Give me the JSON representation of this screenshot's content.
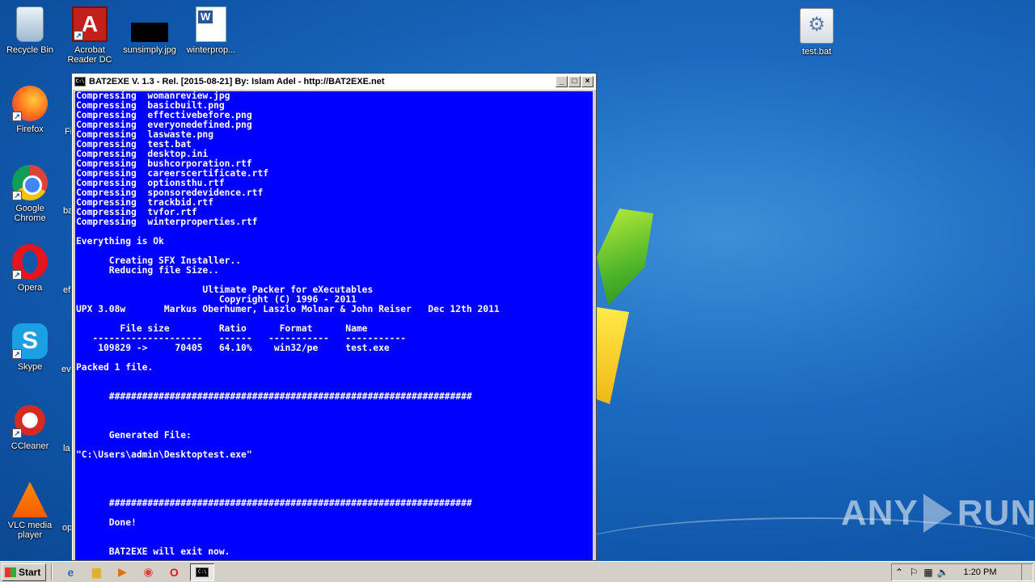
{
  "desktop": {
    "icons": [
      {
        "label": "Recycle Bin",
        "icon": "recycle-bin-icon"
      },
      {
        "label": "Acrobat Reader DC",
        "icon": "acrobat-reader-icon"
      },
      {
        "label": "sunsimply.jpg",
        "icon": "image-file-icon"
      },
      {
        "label": "winterprop...",
        "icon": "word-document-icon"
      },
      {
        "label": "test.bat",
        "icon": "batch-file-icon"
      },
      {
        "label": "Firefox",
        "icon": "firefox-icon"
      },
      {
        "label": "Google Chrome",
        "icon": "chrome-icon"
      },
      {
        "label": "Opera",
        "icon": "opera-icon"
      },
      {
        "label": "Skype",
        "icon": "skype-icon"
      },
      {
        "label": "CCleaner",
        "icon": "ccleaner-icon"
      },
      {
        "label": "VLC media player",
        "icon": "vlc-icon"
      }
    ],
    "partial_labels": [
      "Fi",
      "ba",
      "ef",
      "ev",
      "la",
      "op"
    ]
  },
  "window": {
    "title": "BAT2EXE V. 1.3 - Rel. [2015-08-21] By: Islam Adel - http://BAT2EXE.net",
    "console_lines": [
      "Compressing  womanreview.jpg",
      "Compressing  basicbuilt.png",
      "Compressing  effectivebefore.png",
      "Compressing  everyonedefined.png",
      "Compressing  laswaste.png",
      "Compressing  test.bat",
      "Compressing  desktop.ini",
      "Compressing  bushcorporation.rtf",
      "Compressing  careerscertificate.rtf",
      "Compressing  optionsthu.rtf",
      "Compressing  sponsoredevidence.rtf",
      "Compressing  trackbid.rtf",
      "Compressing  tvfor.rtf",
      "Compressing  winterproperties.rtf",
      "",
      "Everything is Ok",
      "",
      "      Creating SFX Installer..",
      "      Reducing file Size..",
      "",
      "                       Ultimate Packer for eXecutables",
      "                          Copyright (C) 1996 - 2011",
      "UPX 3.08w       Markus Oberhumer, Laszlo Molnar & John Reiser   Dec 12th 2011",
      "",
      "        File size         Ratio      Format      Name",
      "   --------------------   ------   -----------   -----------",
      "    109829 ->     70405   64.10%    win32/pe     test.exe",
      "",
      "Packed 1 file.",
      "",
      "",
      "      ##################################################################",
      "",
      "",
      "",
      "      Generated File:",
      "",
      "\"C:\\Users\\admin\\Desktoptest.exe\"",
      "",
      "",
      "",
      "",
      "      ##################################################################",
      "",
      "      Done!",
      "",
      "",
      "      BAT2EXE will exit now.",
      "",
      "",
      "      ##################################################################"
    ]
  },
  "taskbar": {
    "start_label": "Start",
    "clock": "1:20 PM"
  },
  "watermark": {
    "left": "ANY",
    "right": "RUN"
  }
}
